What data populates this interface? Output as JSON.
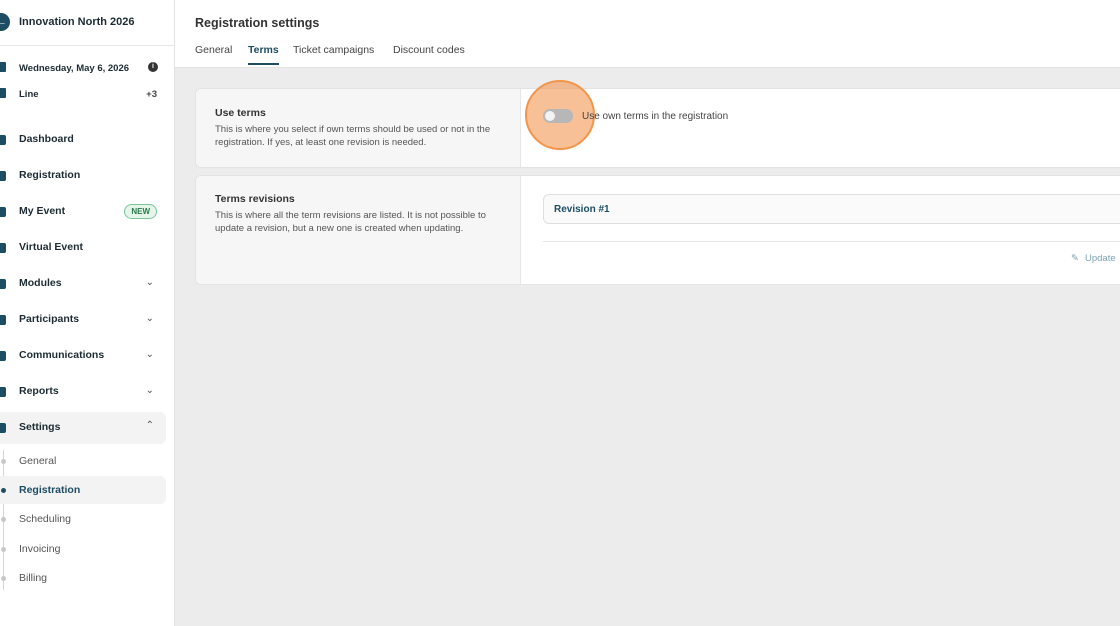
{
  "sidebar": {
    "event_title": "Innovation North 2026",
    "date": "Wednesday, May 6, 2026",
    "line_label": "Line",
    "line_extra": "+3",
    "nav": [
      {
        "label": "Dashboard",
        "icon": "dashboard-icon"
      },
      {
        "label": "Registration",
        "icon": "registration-icon"
      },
      {
        "label": "My Event",
        "icon": "my-event-icon",
        "badge": "NEW"
      },
      {
        "label": "Virtual Event",
        "icon": "virtual-event-icon"
      },
      {
        "label": "Modules",
        "icon": "modules-icon"
      },
      {
        "label": "Participants",
        "icon": "participants-icon"
      },
      {
        "label": "Communications",
        "icon": "communications-icon"
      },
      {
        "label": "Reports",
        "icon": "reports-icon"
      },
      {
        "label": "Settings",
        "icon": "settings-icon"
      }
    ],
    "settings_sub": [
      "General",
      "Registration",
      "Scheduling",
      "Invoicing",
      "Billing"
    ]
  },
  "header": {
    "title": "Registration settings",
    "tabs": [
      "General",
      "Terms",
      "Ticket campaigns",
      "Discount codes"
    ],
    "active_tab": "Terms"
  },
  "use_terms": {
    "title": "Use terms",
    "description": "This is where you select if own terms should be used or not in the registration. If yes, at least one revision is needed.",
    "toggle_label": "Use own terms in the registration",
    "toggle_on": false
  },
  "revisions": {
    "title": "Terms revisions",
    "description": "This is where all the term revisions are listed. It is not possible to update a revision, but a new one is created when updating.",
    "items": [
      "Revision #1"
    ],
    "update_label": "Update"
  },
  "colors": {
    "accent": "#1d4d63",
    "highlight": "#f2954a",
    "new_badge": "#2b7a4b"
  }
}
